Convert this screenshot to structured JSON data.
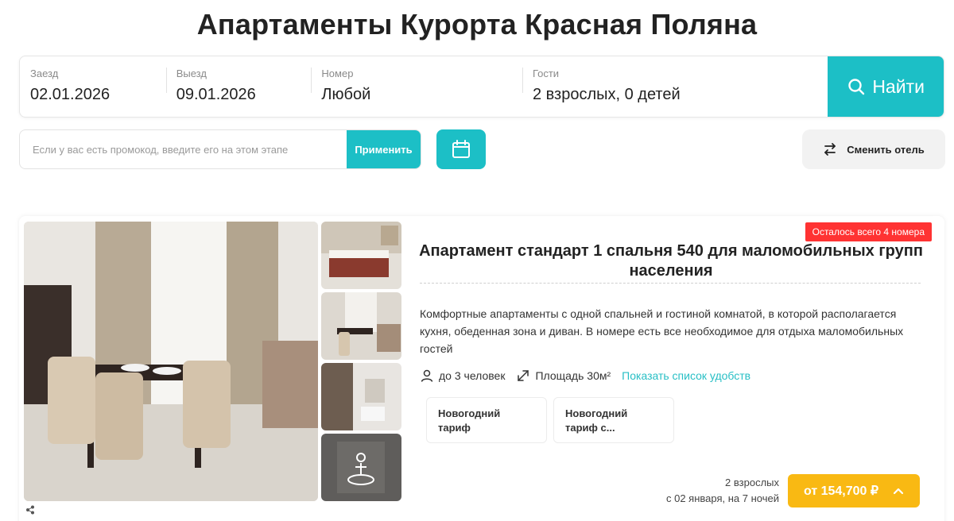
{
  "page": {
    "title": "Апартаменты Курорта Красная Поляна"
  },
  "search": {
    "checkin": {
      "label": "Заезд",
      "value": "02.01.2026"
    },
    "checkout": {
      "label": "Выезд",
      "value": "09.01.2026"
    },
    "room": {
      "label": "Номер",
      "value": "Любой"
    },
    "guests": {
      "label": "Гости",
      "value": "2 взрослых, 0 детей"
    },
    "button_label": "Найти"
  },
  "promo": {
    "placeholder": "Если у вас есть промокод, введите его на этом этапе",
    "apply_label": "Применить"
  },
  "change_hotel_label": "Сменить отель",
  "room_card": {
    "badge": "Осталось всего 4 номера",
    "title": "Апартамент стандарт 1 спальня 540 для маломобильных групп населения",
    "description": "Комфортные апартаменты с одной спальней и гостиной комнатой, в которой располагается кухня, обеденная зона и диван. В номере есть все необходимое для отдыха маломобильных гостей",
    "capacity": "до 3 человек",
    "area": "Площадь 30м²",
    "amenities_link": "Показать список удобств",
    "tariffs": [
      {
        "line1": "Новогодний",
        "line2": "тариф"
      },
      {
        "line1": "Новогодний",
        "line2": "тариф с..."
      }
    ],
    "price_guests": "2 взрослых",
    "price_dates": "с 02 января, на 7 ночей",
    "price_button": "от 154,700 ₽"
  },
  "colors": {
    "accent": "#1cbfc6",
    "price": "#f9b913",
    "badge": "#ff3333"
  },
  "icons": [
    "search-icon",
    "calendar-icon",
    "swap-icon",
    "person-icon",
    "area-icon",
    "chevron-up-icon",
    "share-icon",
    "accessibility-icon"
  ]
}
